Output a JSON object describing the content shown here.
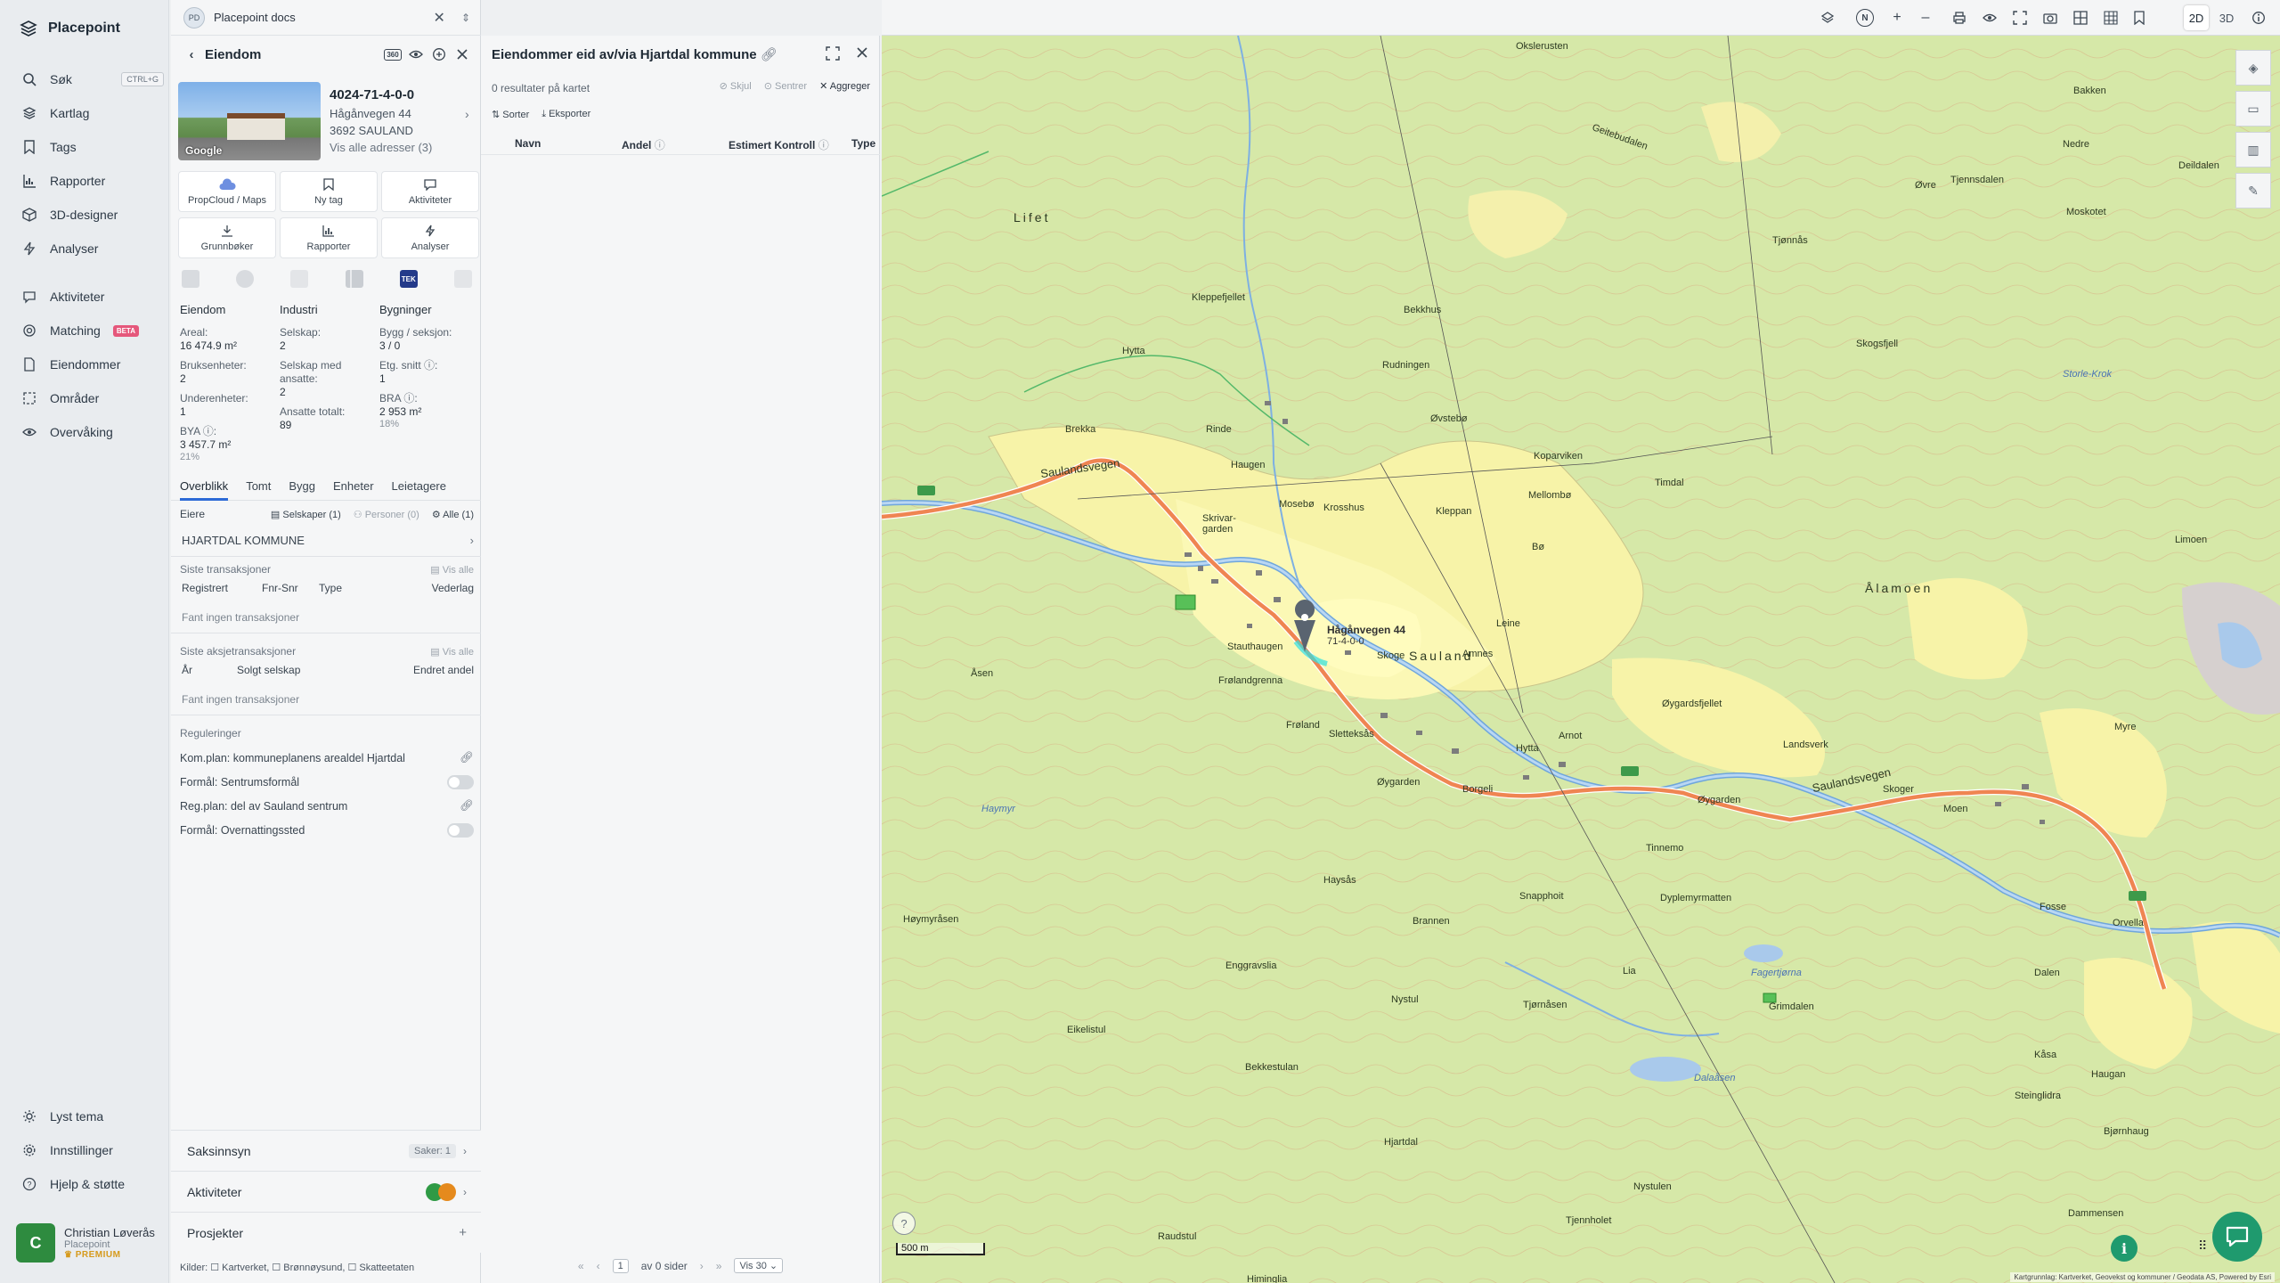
{
  "app": {
    "name": "Placepoint"
  },
  "nav": {
    "items": [
      {
        "label": "Søk",
        "shortcut": "CTRL+G",
        "icon": "search-icon"
      },
      {
        "label": "Kartlag",
        "icon": "layers-icon"
      },
      {
        "label": "Tags",
        "icon": "bookmark-icon"
      },
      {
        "label": "Rapporter",
        "icon": "bar-chart-icon"
      },
      {
        "label": "3D-designer",
        "icon": "cube-icon"
      },
      {
        "label": "Analyser",
        "icon": "bolt-icon"
      },
      {
        "label": "Aktiviteter",
        "icon": "chat-icon"
      },
      {
        "label": "Matching",
        "badge": "BETA",
        "icon": "target-icon"
      },
      {
        "label": "Eiendommer",
        "icon": "document-icon"
      },
      {
        "label": "Områder",
        "icon": "area-icon"
      },
      {
        "label": "Overvåking",
        "icon": "eye-icon"
      }
    ],
    "bottom": [
      {
        "label": "Lyst tema",
        "icon": "sun-icon"
      },
      {
        "label": "Innstillinger",
        "icon": "gear-icon"
      },
      {
        "label": "Hjelp & støtte",
        "icon": "help-icon"
      }
    ],
    "user": {
      "initial": "C",
      "name": "Christian Løverås",
      "company": "Placepoint",
      "plan": "PREMIUM"
    }
  },
  "doc": {
    "avatar": "PD",
    "title": "Placepoint docs"
  },
  "property": {
    "header": "Eiendom",
    "badge": "360",
    "id": "4024-71-4-0-0",
    "address1": "Hågånvegen 44",
    "address2": "3692 SAULAND",
    "all_addresses": "Vis alle adresser (3)",
    "photo_label": "Google",
    "tiles": [
      {
        "label": "PropCloud / Maps",
        "icon": "cloud-icon"
      },
      {
        "label": "Ny tag",
        "icon": "bookmark-icon"
      },
      {
        "label": "Aktiviteter",
        "icon": "chat-icon"
      },
      {
        "label": "Grunnbøker",
        "icon": "download-icon"
      },
      {
        "label": "Rapporter",
        "icon": "bar-chart-icon"
      },
      {
        "label": "Analyser",
        "icon": "bolt-icon"
      }
    ],
    "tek_label": "TEK",
    "stats": {
      "eiendom": {
        "heading": "Eiendom",
        "areal_label": "Areal:",
        "areal": "16 474.9 m²",
        "bruks_label": "Bruksenheter:",
        "bruks": "2",
        "under_label": "Underenheter:",
        "under": "1",
        "bya_label": "BYA ⓘ:",
        "bya": "3 457.7 m²",
        "bya_pct": "21%"
      },
      "industri": {
        "heading": "Industri",
        "selskap_label": "Selskap:",
        "selskap": "2",
        "ansatte_label": "Selskap med ansatte:",
        "ansatte": "2",
        "totalt_label": "Ansatte totalt:",
        "totalt": "89"
      },
      "bygninger": {
        "heading": "Bygninger",
        "bygg_label": "Bygg / seksjon:",
        "bygg": "3 / 0",
        "etg_label": "Etg. snitt ⓘ:",
        "etg": "1",
        "bra_label": "BRA ⓘ:",
        "bra": "2 953 m²",
        "bra_pct": "18%"
      }
    },
    "tabs": [
      "Overblikk",
      "Tomt",
      "Bygg",
      "Enheter",
      "Leietagere"
    ],
    "owners": {
      "label": "Eiere",
      "f1": "Selskaper (1)",
      "f2": "Personer (0)",
      "f3": "Alle (1)",
      "owner": "HJARTDAL KOMMUNE"
    },
    "transactions": {
      "label": "Siste transaksjoner",
      "show_all": "Vis alle",
      "cols": [
        "Registrert",
        "Fnr-Snr",
        "Type",
        "Vederlag"
      ],
      "empty": "Fant ingen transaksjoner"
    },
    "share_tx": {
      "label": "Siste aksjetransaksjoner",
      "show_all": "Vis alle",
      "cols": [
        "År",
        "Solgt selskap",
        "Endret andel"
      ],
      "empty": "Fant ingen transaksjoner"
    },
    "regulations": {
      "label": "Reguleringer",
      "items": [
        "Kom.plan: kommuneplanens arealdel Hjartdal",
        "Formål: Sentrumsformål",
        "Reg.plan: del av Sauland sentrum",
        "Formål: Overnattingssted"
      ]
    },
    "accordions": {
      "saksinnsyn": "Saksinnsyn",
      "saker": "Saker:",
      "saker_count": "1",
      "aktiviteter": "Aktiviteter",
      "prosjekter": "Prosjekter"
    },
    "sources": "Kilder: ☐ Kartverket, ☐ Brønnøysund, ☐ Skatteetaten"
  },
  "list": {
    "title": "Eiendommer eid av/via Hjartdal kommune",
    "count": "0 resultater på kartet",
    "actions": [
      "Skjul",
      "Sentrer",
      "Aggreger"
    ],
    "tools": [
      "Sorter",
      "Eksporter"
    ],
    "columns": [
      "Navn",
      "Andel",
      "Estimert Kontroll",
      "Type"
    ],
    "pager": {
      "page": "1",
      "of": "av 0 sider",
      "per": "Vis 30"
    }
  },
  "map": {
    "scale": "500 m",
    "attribution": "Kartgrunnlag: Kartverket, Geovekst og kommuner / Geodata AS, Powered by Esri",
    "marker_label": "Hågånvegen 44",
    "marker_sub": "71-4-0-0",
    "labels": [
      "Okslerusten",
      "Geitebudalen",
      "Bakken",
      "Nedre",
      "Tjennsdalen",
      "Øvre",
      "Moskotet",
      "Deildalen",
      "Lifet",
      "Tjønnås",
      "Kleppefjellet",
      "Bekkhus",
      "Hytta",
      "Rudningen",
      "Skogsfjell",
      "Storle-Krok",
      "Øvstebø",
      "Brekka",
      "Rinde",
      "Haugen",
      "Koparviken",
      "Timdal",
      "Sauland",
      "Saulandsvegen",
      "Mosebø",
      "Krosshus",
      "Kleppan",
      "Mellombø",
      "Limoen",
      "Skrivar-garden",
      "Bø",
      "Leine",
      "Stauthaugen",
      "Skoge",
      "Amnes",
      "Åsen",
      "Frølandgrenna",
      "Frøland",
      "Sletteksås",
      "Øygardsfjellet",
      "Landsverk",
      "Myre",
      "Hytta",
      "Arnot",
      "Øygarden",
      "Borgeli",
      "Øygarden",
      "Skoger",
      "Moen",
      "Tinnemo",
      "Haymyr",
      "Haysås",
      "Snapphoit",
      "Dyplemyrmatten",
      "Fosse",
      "Brannen",
      "Orvella",
      "Høymyråsen",
      "Enggravslia",
      "Lia",
      "Fagertjørna",
      "Grimdalen",
      "Dalen",
      "Nystul",
      "Tjørnåsen",
      "Eikelistul",
      "Bekkestulan",
      "Dalaåsen",
      "Haugan",
      "Kåsa",
      "Steinglidra",
      "Bjørnhaug",
      "Hjartdal",
      "Hjartdal",
      "Raudstul",
      "Himinglia",
      "Nystulen",
      "Tjennholet",
      "Dammensen"
    ],
    "big_labels": [
      "Lifet",
      "Sauland",
      "Ålamoen"
    ],
    "road_labels": [
      "Saulandsvegen",
      "Saulandsvegen"
    ]
  },
  "toolbar": {
    "mode2d": "2D",
    "mode3d": "3D"
  }
}
